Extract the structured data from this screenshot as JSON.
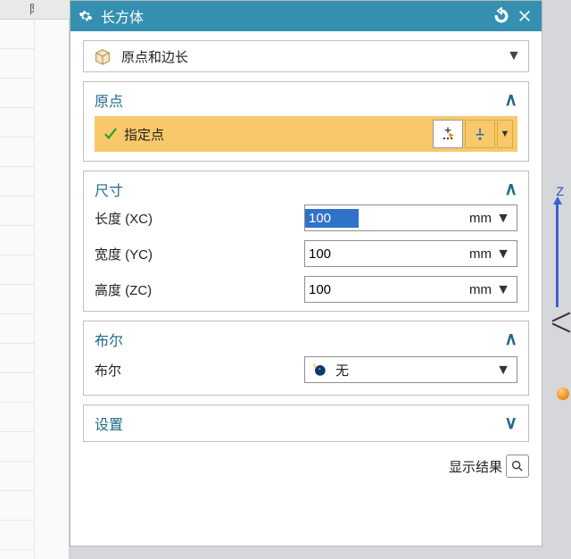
{
  "titlebar": {
    "title": "长方体"
  },
  "left_header": "阝",
  "type_selector": {
    "label": "原点和边长"
  },
  "sections": {
    "origin": {
      "title": "原点",
      "specify_point": "指定点"
    },
    "dimensions": {
      "title": "尺寸",
      "rows": [
        {
          "label": "长度 (XC)",
          "value": "100",
          "unit": "mm",
          "selected": true
        },
        {
          "label": "宽度 (YC)",
          "value": "100",
          "unit": "mm",
          "selected": false
        },
        {
          "label": "高度 (ZC)",
          "value": "100",
          "unit": "mm",
          "selected": false
        }
      ]
    },
    "boolean": {
      "title": "布尔",
      "field_label": "布尔",
      "value": "无"
    },
    "settings": {
      "title": "设置"
    }
  },
  "bottom": {
    "show_result": "显示结果"
  },
  "viewport": {
    "z_label": "Z"
  }
}
